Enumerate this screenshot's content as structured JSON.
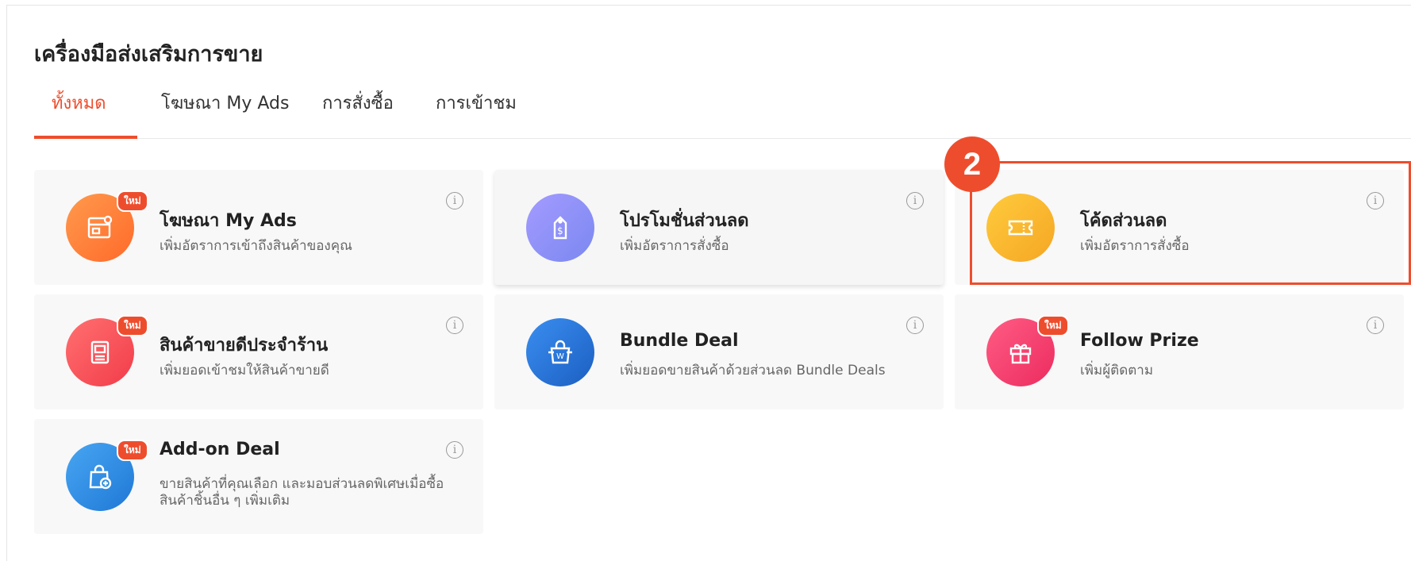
{
  "page_title": "เครื่องมือส่งเสริมการขาย",
  "tabs": [
    {
      "label": "ทั้งหมด",
      "active": true
    },
    {
      "label": "โฆษณา My Ads",
      "active": false
    },
    {
      "label": "การสั่งซื้อ",
      "active": false
    },
    {
      "label": "การเข้าชม",
      "active": false
    }
  ],
  "annotation": {
    "step_number": "2"
  },
  "cards": [
    {
      "title": "โฆษณา My Ads",
      "desc": "เพิ่มอัตราการเข้าถึงสินค้าของคุณ",
      "badge": "ใหม่",
      "icon": "ads-icon",
      "color": "#ff7a3d"
    },
    {
      "title": "โปรโมชั่นส่วนลด",
      "desc": "เพิ่มอัตราการสั่งซื้อ",
      "badge": "",
      "icon": "price-tag-icon",
      "color": "#8c8cf5"
    },
    {
      "title": "โค้ดส่วนลด",
      "desc": "เพิ่มอัตราการสั่งซื้อ",
      "badge": "",
      "icon": "voucher-icon",
      "color": "#fbb829"
    },
    {
      "title": "สินค้าขายดีประจำร้าน",
      "desc": "เพิ่มยอดเข้าชมให้สินค้าขายดี",
      "badge": "ใหม่",
      "icon": "top-picks-icon",
      "color": "#fa5a5a"
    },
    {
      "title": "Bundle Deal",
      "desc": "เพิ่มยอดขายสินค้าด้วยส่วนลด Bundle Deals",
      "badge": "",
      "icon": "bundle-icon",
      "color": "#2a75d8"
    },
    {
      "title": "Follow Prize",
      "desc": "เพิ่มผู้ติดตาม",
      "badge": "ใหม่",
      "icon": "gift-icon",
      "color": "#f7466f"
    },
    {
      "title": "Add-on Deal",
      "desc": "ขายสินค้าที่คุณเลือก และมอบส่วนลดพิเศษเมื่อซื้อสินค้าชิ้นอื่น ๆ เพิ่มเติม",
      "badge": "ใหม่",
      "icon": "add-on-bag-icon",
      "color": "#2f8fe0"
    }
  ],
  "info_symbol": "i"
}
